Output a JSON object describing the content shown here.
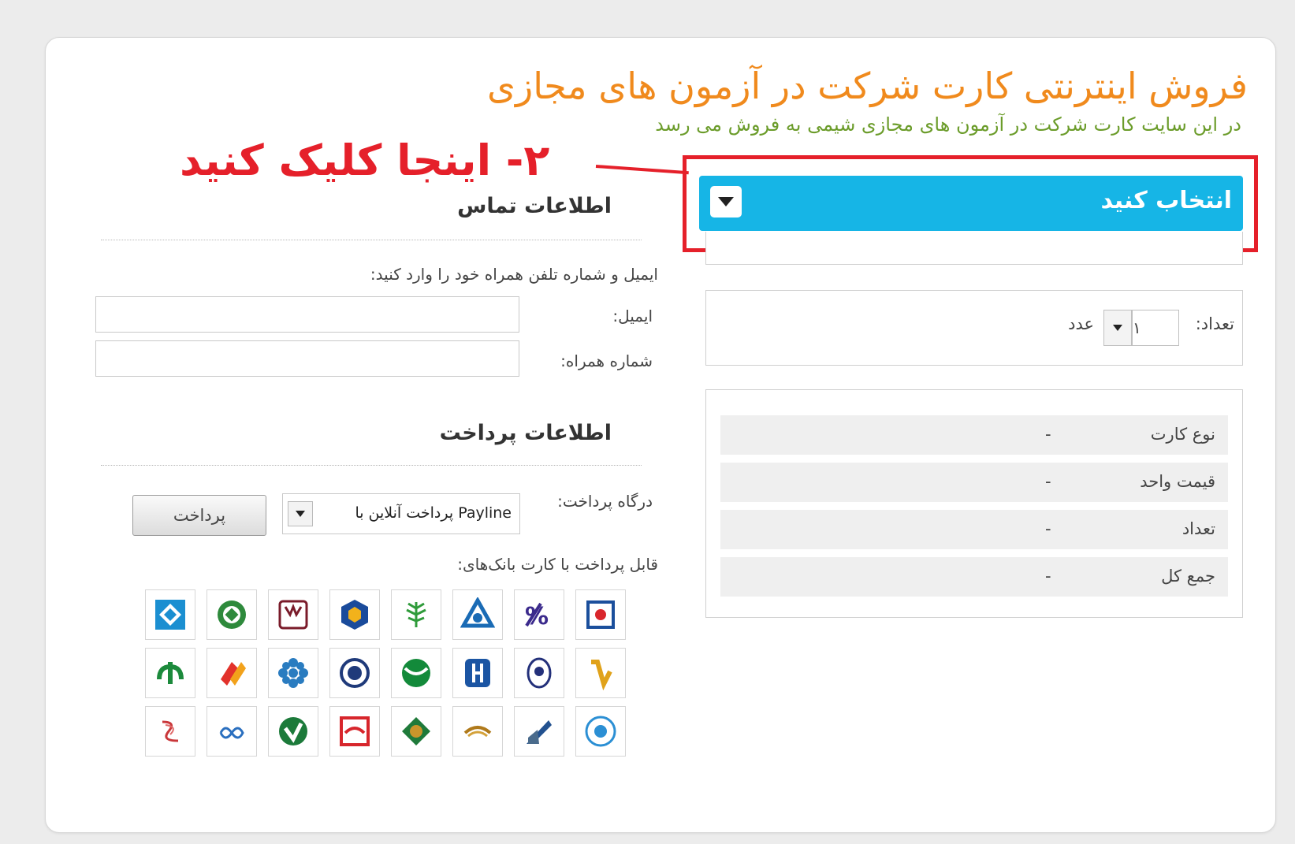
{
  "header": {
    "title": "فروش اینترنتی کارت شرکت در آزمون های مجازی",
    "subtitle": "در این سایت کارت شرکت در آزمون های مجازی شیمی به فروش می رسد"
  },
  "annotation": {
    "text": "۲- اینجا کلیک کنید"
  },
  "product_select": {
    "label": "انتخاب کنید"
  },
  "quantity": {
    "label": "تعداد:",
    "value": "۱",
    "unit": "عدد"
  },
  "summary": {
    "rows": [
      {
        "key": "نوع کارت",
        "value": "-"
      },
      {
        "key": "قیمت واحد",
        "value": "-"
      },
      {
        "key": "تعداد",
        "value": "-"
      },
      {
        "key": "جمع کل",
        "value": "-"
      }
    ]
  },
  "contact": {
    "title": "اطلاعات تماس",
    "instruction": "ایمیل و شماره تلفن همراه خود را وارد کنید:",
    "email_label": "ایمیل:",
    "email_value": "",
    "mobile_label": "شماره همراه:",
    "mobile_value": ""
  },
  "payment": {
    "title": "اطلاعات پرداخت",
    "gateway_label": "درگاه پرداخت:",
    "gateway_selected": "پرداخت آنلاین با Payline",
    "pay_button": "پرداخت",
    "banks_label": "قابل پرداخت با کارت بانک‌های:"
  },
  "bank_icons": [
    "bank-melli-icon",
    "bank-pasargad-icon",
    "bank-mellat-icon",
    "bank-keshavarzi-icon",
    "bank-sepah-icon",
    "bank-ayandeh-icon",
    "bank-karafarin-icon",
    "bank-maskan-icon",
    "bank-refah-icon",
    "bank-saderat-icon",
    "bank-saman-icon",
    "bank-sepah-alt-icon",
    "bank-tejarat-icon",
    "bank-eghtesad-novin-icon",
    "bank-sina-icon",
    "bank-resalat-icon",
    "bank-post-icon",
    "bank-sarmayeh-icon",
    "bank-parsian-icon",
    "bank-tosee-icon",
    "bank-ansar-icon",
    "bank-dey-icon",
    "bank-shahr-icon",
    "bank-gardeshgari-icon"
  ],
  "colors": {
    "title": "#f08a1d",
    "subtitle": "#6b9c2a",
    "annotation": "#e5202a",
    "select_bar": "#16b5e6"
  }
}
